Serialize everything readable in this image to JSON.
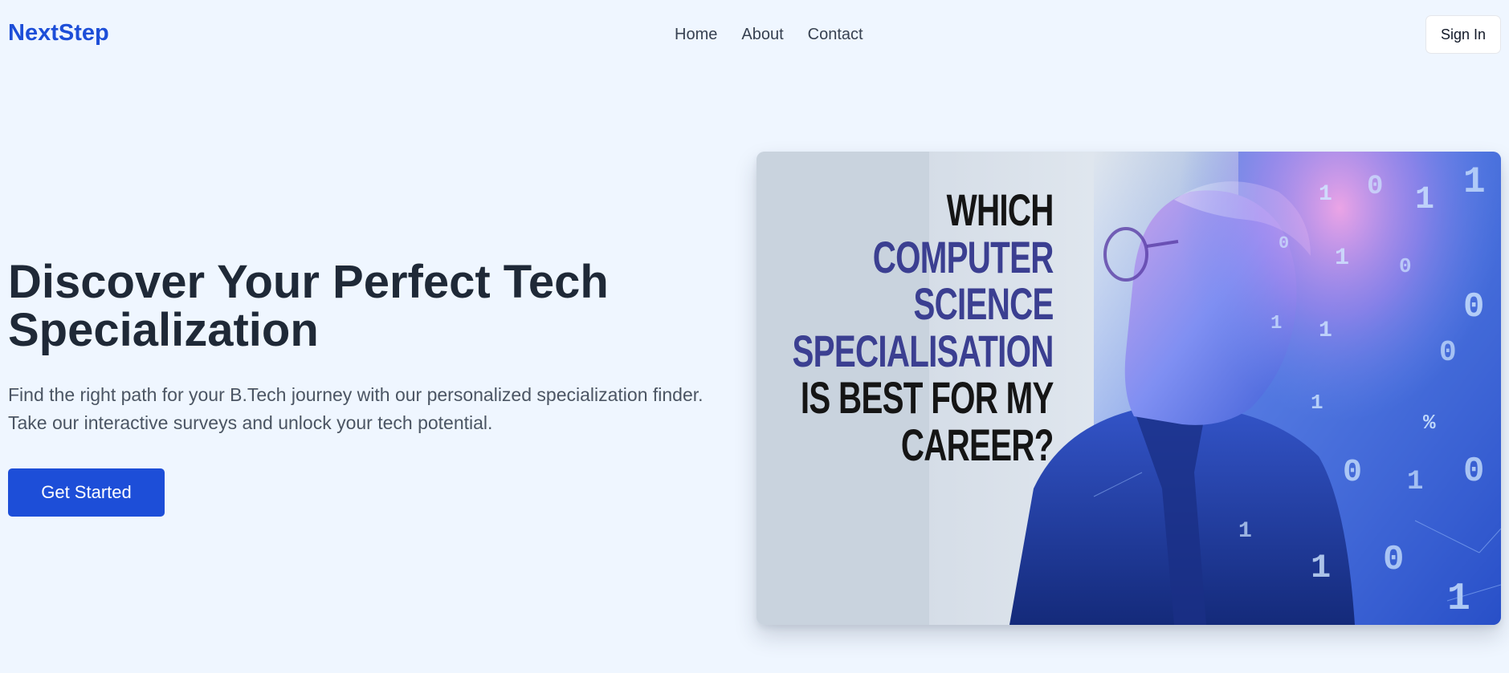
{
  "header": {
    "logo": "NextStep",
    "nav": [
      "Home",
      "About",
      "Contact"
    ],
    "signin_label": "Sign In"
  },
  "hero": {
    "title": "Discover Your Perfect Tech Specialization",
    "description": "Find the right path for your B.Tech journey with our personalized specialization finder. Take our interactive surveys and unlock your tech potential.",
    "cta_label": "Get Started"
  },
  "image": {
    "headline_lines": [
      "WHICH",
      "COMPUTER",
      "SCIENCE",
      "SPECIALISATION",
      "IS BEST FOR MY",
      "CAREER?"
    ],
    "binary_glyphs": [
      "1",
      "0",
      "1",
      "1",
      "0",
      "1",
      "0",
      "0",
      "1",
      "1",
      "0",
      "1",
      "%",
      "0",
      "1",
      "0",
      "1",
      "1",
      "0",
      "1"
    ]
  },
  "colors": {
    "brand": "#1d4ed8",
    "background": "#eff6ff",
    "headline_accent": "#3b3f91",
    "headline_dark": "#151515"
  }
}
